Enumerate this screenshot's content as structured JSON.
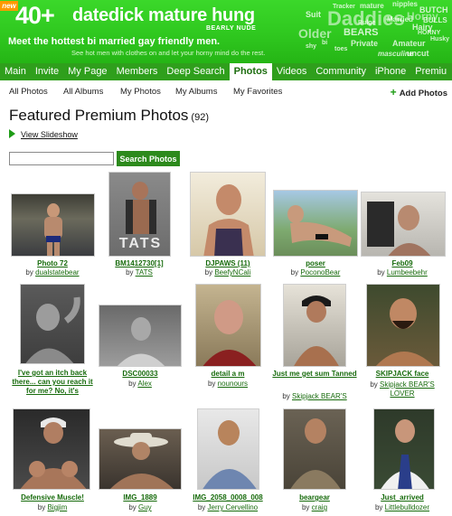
{
  "header": {
    "new_badge": "new",
    "logo_num": "40+",
    "logo_text": "datedick mature hung",
    "logo_small": "BEARLY NUDE",
    "tagline": "Meet the hottest bi married gay friendly men.",
    "subtag": "See hot men with clothes on and let your horny mind do the rest.",
    "wordcloud": [
      "Daddies",
      "Suit",
      "Tracker",
      "mature",
      "nipples",
      "BUTCH",
      "BULLS",
      "Older",
      "BEARS",
      "Hairy",
      "Husky",
      "Married",
      "Private",
      "Amateur",
      "uncut",
      "masculine",
      "bi",
      "HORNY",
      "toes",
      "shy",
      "Bulge",
      "Horny"
    ]
  },
  "nav": {
    "items": [
      "Main",
      "Invite",
      "My Page",
      "Members",
      "Deep Search",
      "Photos",
      "Videos",
      "Community",
      "iPhone",
      "Premiu"
    ],
    "active_index": 5
  },
  "subnav": {
    "items": [
      "All Photos",
      "All Albums",
      "My Photos",
      "My Albums",
      "My Favorites"
    ],
    "add_label": "Add Photos"
  },
  "page": {
    "title": "Featured Premium Photos",
    "count": "(92)",
    "slideshow_label": "View Slideshow"
  },
  "search": {
    "value": "",
    "placeholder": "",
    "button_label": "Search Photos"
  },
  "photos": [
    {
      "title": "Photo 72",
      "by": "by",
      "user": "dualstatebear"
    },
    {
      "title": "BM1412730[1]",
      "by": "by",
      "user": "TATS",
      "image_text": "TATS"
    },
    {
      "title": "DJPAWS (11)",
      "by": "by",
      "user": "BeefyNCali"
    },
    {
      "title": "poser",
      "by": "by",
      "user": "PoconoBear"
    },
    {
      "title": "Feb09",
      "by": "by",
      "user": "Lumbeebehr"
    },
    {
      "title": "I've got an itch back there... can you reach it for me? No, it's",
      "by": "",
      "user": ""
    },
    {
      "title": "DSC00033",
      "by": "by",
      "user": "Alex"
    },
    {
      "title": "detail a m",
      "by": "by",
      "user": "nounours"
    },
    {
      "title": "Just me get sum Tanned",
      "by": "by",
      "user": "Skipjack BEAR'S"
    },
    {
      "title": "SKIPJACK face",
      "by": "by",
      "user": "Skipjack BEAR'S LOVER"
    },
    {
      "title": "Defensive Muscle!",
      "by": "by",
      "user": "Bigjim"
    },
    {
      "title": "IMG_1889",
      "by": "by",
      "user": "Guy"
    },
    {
      "title": "IMG_2058_0008_008",
      "by": "by",
      "user": "Jerry Cervellino"
    },
    {
      "title": "beargear",
      "by": "by",
      "user": "craig"
    },
    {
      "title": "Just_arrived",
      "by": "by",
      "user": "Littlebulldozer"
    }
  ],
  "colors": {
    "header_green": "#2fc81f",
    "nav_green": "#2f9f1c",
    "link_green": "#176b0c",
    "button_green": "#2c8a1c"
  }
}
